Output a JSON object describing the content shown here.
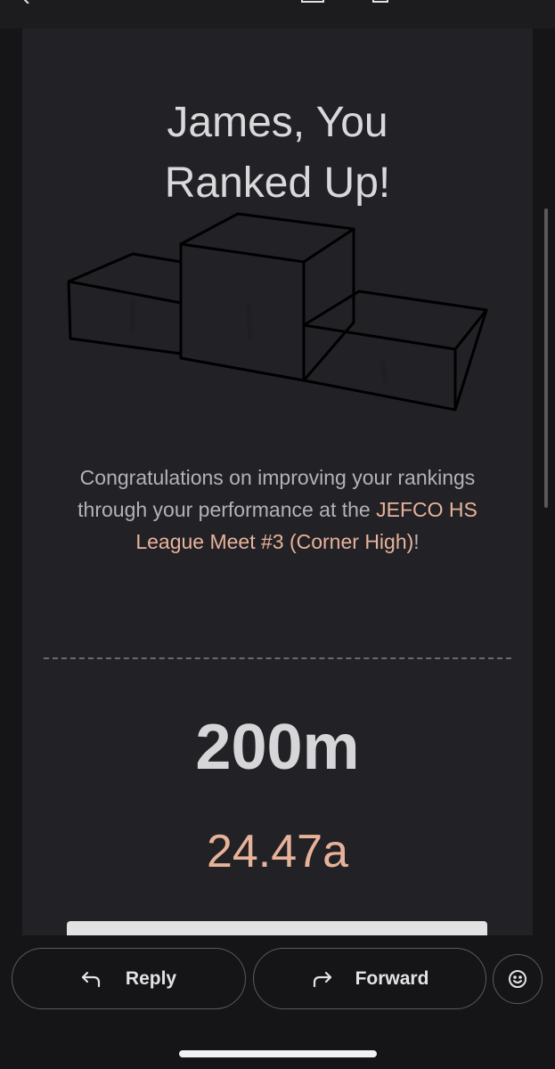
{
  "email": {
    "headline_line1": "James, You",
    "headline_line2": "Ranked Up!",
    "congrats_prefix": "Congratulations on improving your rankings through your performance at the ",
    "meet_name": "JEFCO HS League Meet #3 (Corner High)",
    "congrats_suffix": "!",
    "event_name": "200m",
    "event_time": "24.47a",
    "accent_color": "#e8b29a"
  },
  "actions": {
    "reply_label": "Reply",
    "forward_label": "Forward"
  },
  "icons": {
    "back": "arrow-left-icon",
    "archive": "archive-icon",
    "delete": "trash-icon",
    "podium": "podium-icon",
    "reply": "reply-arrow-icon",
    "forward": "forward-arrow-icon",
    "emoji": "smiley-icon"
  }
}
